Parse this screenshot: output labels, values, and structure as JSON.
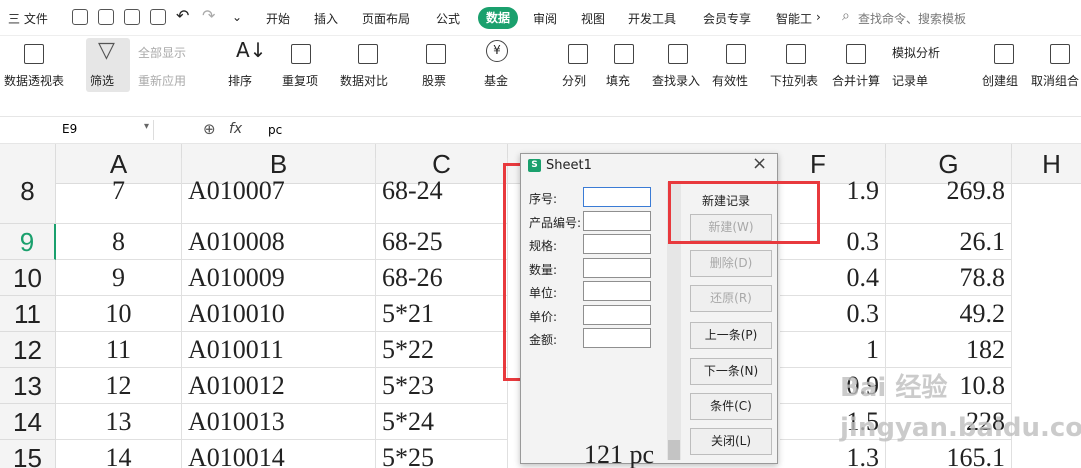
{
  "menubar": {
    "file": "三 文件",
    "tabs": [
      "开始",
      "插入",
      "页面布局",
      "公式",
      "数据",
      "审阅",
      "视图",
      "开发工具",
      "会员专享",
      "智能工"
    ],
    "more": "›",
    "search": "查找命令、搜索模板"
  },
  "ribbon": {
    "pivot": "数据透视表",
    "filter": "筛选",
    "show_all": "全部显示",
    "reapply": "重新应用",
    "sort": "排序",
    "dup": "重复项",
    "compare": "数据对比",
    "stock": "股票",
    "fund": "基金",
    "split": "分列",
    "fill": "填充",
    "lookup": "查找录入",
    "valid": "有效性",
    "dropdown": "下拉列表",
    "consolidate": "合并计算",
    "whatif": "模拟分析",
    "record": "记录单",
    "group": "创建组",
    "ungroup": "取消组合"
  },
  "formula_bar": {
    "cell_ref": "E9",
    "fx": "fx",
    "value": "pc"
  },
  "columns": [
    "A",
    "B",
    "C",
    "",
    "",
    "F",
    "G",
    "H"
  ],
  "rows": [
    {
      "n": "8",
      "a": "7",
      "b": "A010007",
      "c": "68-24",
      "f": "1.9",
      "g": "269.8"
    },
    {
      "n": "9",
      "a": "8",
      "b": "A010008",
      "c": "68-25",
      "f": "0.3",
      "g": "26.1"
    },
    {
      "n": "10",
      "a": "9",
      "b": "A010009",
      "c": "68-26",
      "f": "0.4",
      "g": "78.8"
    },
    {
      "n": "11",
      "a": "10",
      "b": "A010010",
      "c": "5*21",
      "f": "0.3",
      "g": "49.2"
    },
    {
      "n": "12",
      "a": "11",
      "b": "A010011",
      "c": "5*22",
      "f": "1",
      "g": "182"
    },
    {
      "n": "13",
      "a": "12",
      "b": "A010012",
      "c": "5*23",
      "f": "0.9",
      "g": "10.8"
    },
    {
      "n": "14",
      "a": "13",
      "b": "A010013",
      "c": "5*24",
      "f": "1.5",
      "g": "228"
    },
    {
      "n": "15",
      "a": "14",
      "b": "A010014",
      "c": "5*25",
      "f": "1.3",
      "g": "165.1"
    }
  ],
  "dialog": {
    "title": "Sheet1",
    "close": "×",
    "fields": [
      "序号:",
      "产品编号:",
      "规格:",
      "数量:",
      "单位:",
      "单价:",
      "金额:"
    ],
    "new_record": "新建记录",
    "buttons": [
      "新建(W)",
      "删除(D)",
      "还原(R)",
      "上一条(P)",
      "下一条(N)",
      "条件(C)",
      "关闭(L)"
    ],
    "partial": "121 pc"
  },
  "watermark": "Bai 经验\njingyan.baidu.com"
}
